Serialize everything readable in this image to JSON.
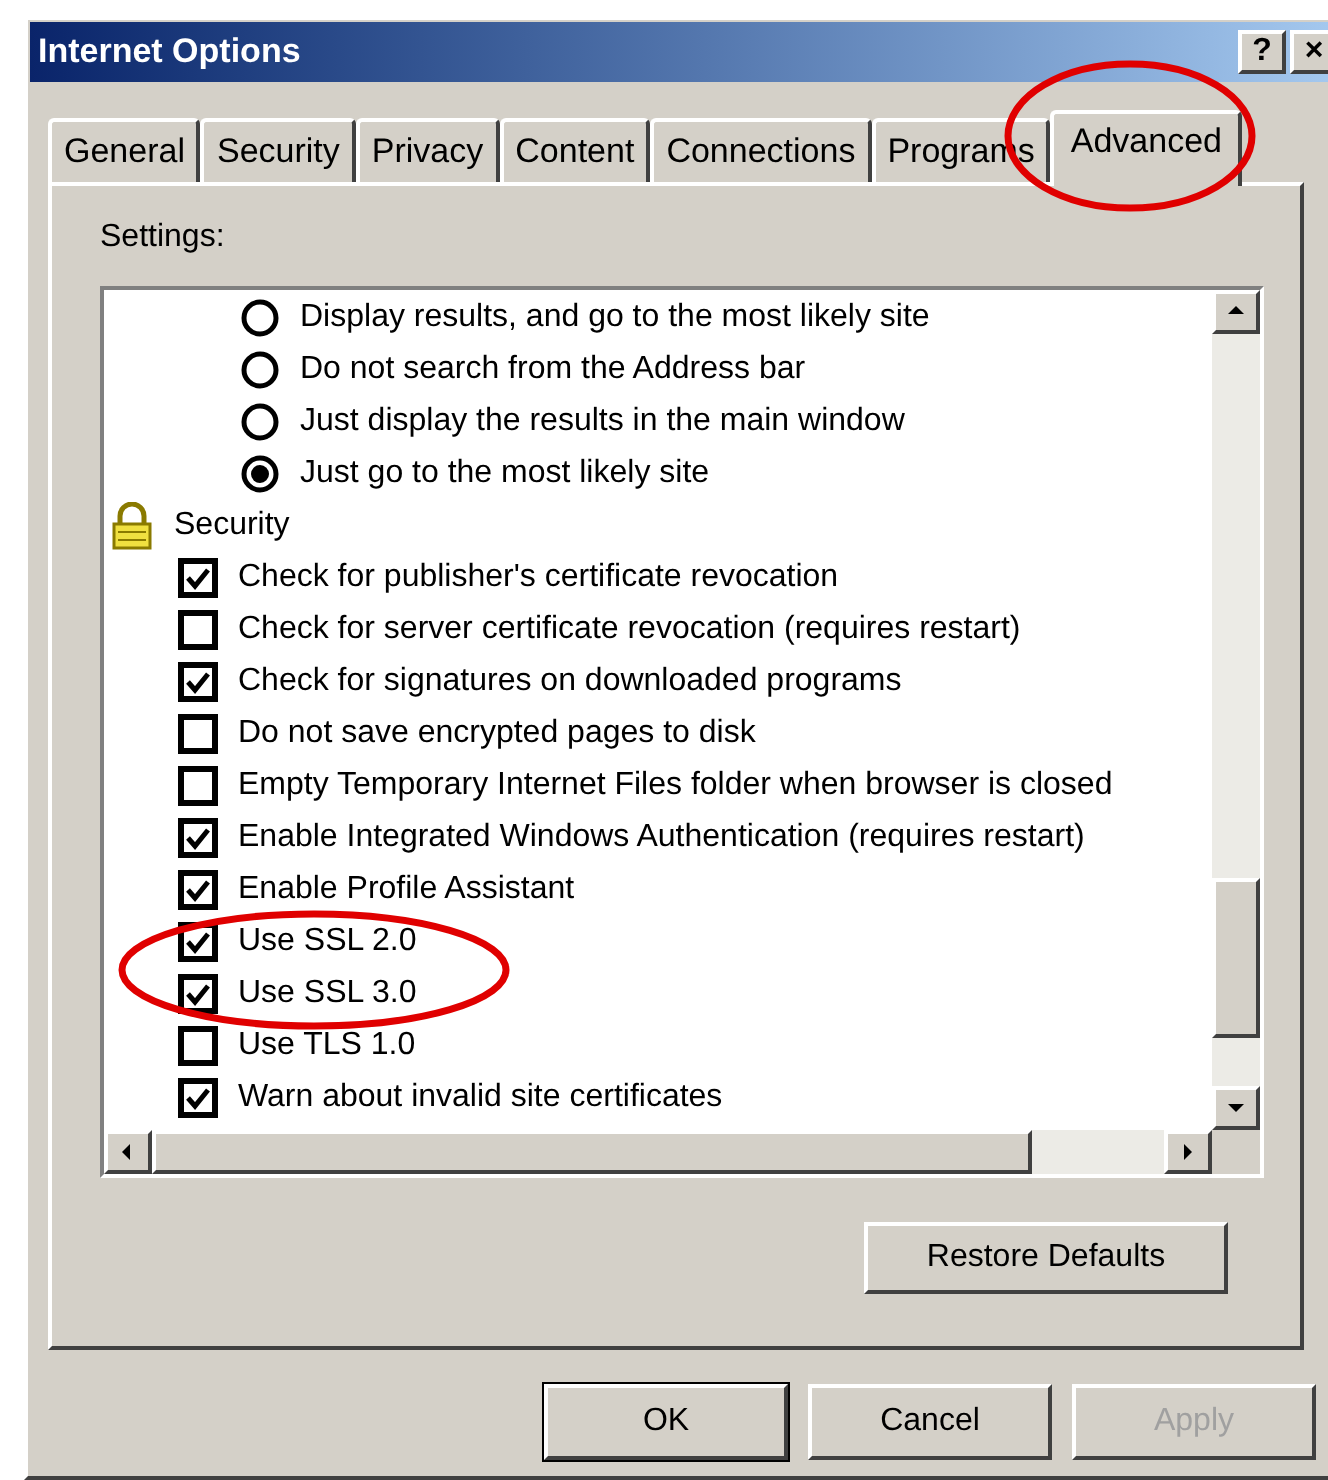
{
  "window": {
    "title": "Internet Options",
    "title_buttons": [
      "?",
      "×"
    ]
  },
  "tabs": [
    {
      "label": "General",
      "selected": false,
      "circled": false
    },
    {
      "label": "Security",
      "selected": false,
      "circled": false
    },
    {
      "label": "Privacy",
      "selected": false,
      "circled": false
    },
    {
      "label": "Content",
      "selected": false,
      "circled": false
    },
    {
      "label": "Connections",
      "selected": false,
      "circled": false
    },
    {
      "label": "Programs",
      "selected": false,
      "circled": false
    },
    {
      "label": "Advanced",
      "selected": true,
      "circled": true
    }
  ],
  "settings": {
    "label": "Settings:",
    "items": [
      {
        "kind": "radio",
        "label": "Display results, and go to the most likely site",
        "selected": false,
        "circled": false
      },
      {
        "kind": "radio",
        "label": "Do not search from the Address bar",
        "selected": false,
        "circled": false
      },
      {
        "kind": "radio",
        "label": "Just display the results in the main window",
        "selected": false,
        "circled": false
      },
      {
        "kind": "radio",
        "label": "Just go to the most likely site",
        "selected": true,
        "circled": false
      },
      {
        "kind": "group",
        "label": "Security",
        "circled": false
      },
      {
        "kind": "checkbox",
        "label": "Check for publisher's certificate revocation",
        "checked": true,
        "circled": false
      },
      {
        "kind": "checkbox",
        "label": "Check for server certificate revocation (requires restart)",
        "checked": false,
        "circled": false
      },
      {
        "kind": "checkbox",
        "label": "Check for signatures on downloaded programs",
        "checked": true,
        "circled": false
      },
      {
        "kind": "checkbox",
        "label": "Do not save encrypted pages to disk",
        "checked": false,
        "circled": false
      },
      {
        "kind": "checkbox",
        "label": "Empty Temporary Internet Files folder when browser is closed",
        "checked": false,
        "circled": false
      },
      {
        "kind": "checkbox",
        "label": "Enable Integrated Windows Authentication (requires restart)",
        "checked": true,
        "circled": false
      },
      {
        "kind": "checkbox",
        "label": "Enable Profile Assistant",
        "checked": true,
        "circled": false
      },
      {
        "kind": "checkbox",
        "label": "Use SSL 2.0",
        "checked": true,
        "circled": true
      },
      {
        "kind": "checkbox",
        "label": "Use SSL 3.0",
        "checked": true,
        "circled": true
      },
      {
        "kind": "checkbox",
        "label": "Use TLS 1.0",
        "checked": false,
        "circled": false
      },
      {
        "kind": "checkbox",
        "label": "Warn about invalid site certificates",
        "checked": true,
        "circled": false
      }
    ]
  },
  "restore_button": "Restore Defaults",
  "buttons": [
    {
      "label": "OK",
      "kind": "default",
      "disabled": false
    },
    {
      "label": "Cancel",
      "kind": "normal",
      "disabled": false
    },
    {
      "label": "Apply",
      "kind": "normal",
      "disabled": true
    }
  ]
}
